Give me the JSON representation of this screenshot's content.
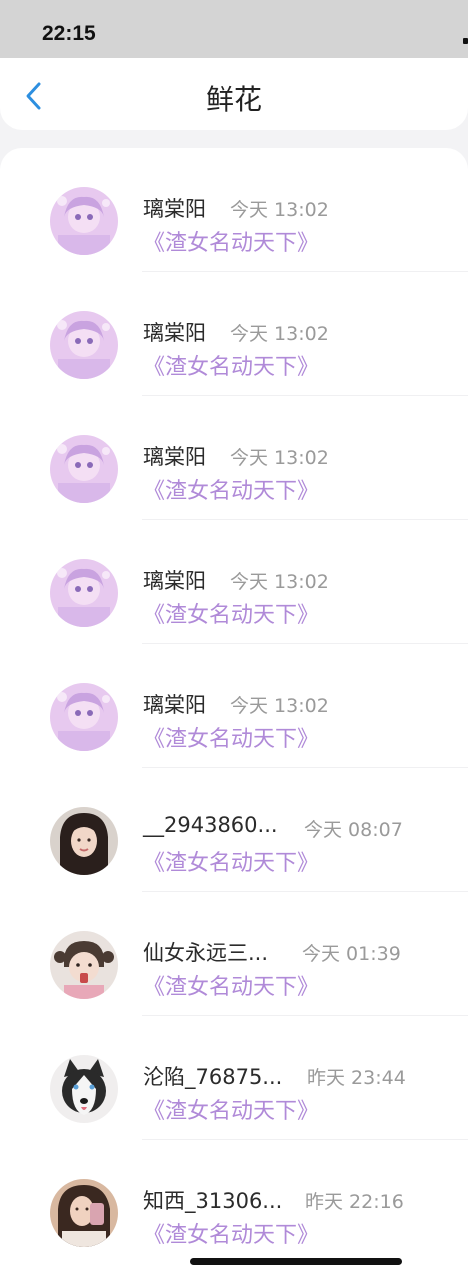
{
  "status_bar": {
    "time": "22:15"
  },
  "header": {
    "title": "鲜花"
  },
  "rows": [
    {
      "name": "璃棠阳",
      "time": "今天 13:02",
      "book": "《渣女名动天下》",
      "avatar_icon": "anime-avatar-icon"
    },
    {
      "name": "璃棠阳",
      "time": "今天 13:02",
      "book": "《渣女名动天下》",
      "avatar_icon": "anime-avatar-icon"
    },
    {
      "name": "璃棠阳",
      "time": "今天 13:02",
      "book": "《渣女名动天下》",
      "avatar_icon": "anime-avatar-icon"
    },
    {
      "name": "璃棠阳",
      "time": "今天 13:02",
      "book": "《渣女名动天下》",
      "avatar_icon": "anime-avatar-icon"
    },
    {
      "name": "璃棠阳",
      "time": "今天 13:02",
      "book": "《渣女名动天下》",
      "avatar_icon": "anime-avatar-icon"
    },
    {
      "name": "__2943860...",
      "time": "今天 08:07",
      "book": "《渣女名动天下》",
      "avatar_icon": "woman-photo-avatar-icon"
    },
    {
      "name": "仙女永远三...",
      "time": "今天 01:39",
      "book": "《渣女名动天下》",
      "avatar_icon": "child-photo-avatar-icon"
    },
    {
      "name": "沦陷_76875...",
      "time": "昨天 23:44",
      "book": "《渣女名动天下》",
      "avatar_icon": "husky-dog-avatar-icon"
    },
    {
      "name": "知西_31306...",
      "time": "昨天 22:16",
      "book": "《渣女名动天下》",
      "avatar_icon": "selfie-photo-avatar-icon"
    }
  ],
  "colors": {
    "book_title": "#b08ad8",
    "back_arrow": "#2d8fe0",
    "time_text": "#9a9a9a"
  }
}
